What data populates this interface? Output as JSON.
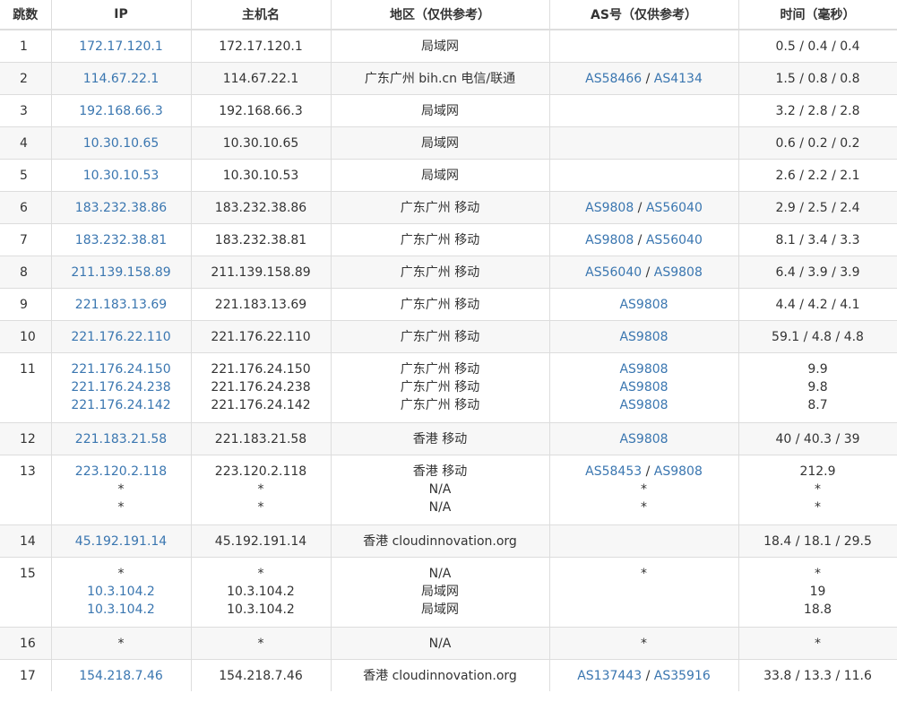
{
  "columns": [
    "跳数",
    "IP",
    "主机名",
    "地区（仅供参考）",
    "AS号（仅供参考）",
    "时间（毫秒）"
  ],
  "hops": [
    {
      "hop": "1",
      "ips": [
        "172.17.120.1"
      ],
      "hosts": [
        "172.17.120.1"
      ],
      "regions": [
        "局域网"
      ],
      "as": [
        []
      ],
      "times": [
        "0.5 / 0.4 / 0.4"
      ]
    },
    {
      "hop": "2",
      "ips": [
        "114.67.22.1"
      ],
      "hosts": [
        "114.67.22.1"
      ],
      "regions": [
        "广东广州 bih.cn 电信/联通"
      ],
      "as": [
        [
          "AS58466",
          "AS4134"
        ]
      ],
      "times": [
        "1.5 / 0.8 / 0.8"
      ]
    },
    {
      "hop": "3",
      "ips": [
        "192.168.66.3"
      ],
      "hosts": [
        "192.168.66.3"
      ],
      "regions": [
        "局域网"
      ],
      "as": [
        []
      ],
      "times": [
        "3.2 / 2.8 / 2.8"
      ]
    },
    {
      "hop": "4",
      "ips": [
        "10.30.10.65"
      ],
      "hosts": [
        "10.30.10.65"
      ],
      "regions": [
        "局域网"
      ],
      "as": [
        []
      ],
      "times": [
        "0.6 / 0.2 / 0.2"
      ]
    },
    {
      "hop": "5",
      "ips": [
        "10.30.10.53"
      ],
      "hosts": [
        "10.30.10.53"
      ],
      "regions": [
        "局域网"
      ],
      "as": [
        []
      ],
      "times": [
        "2.6 / 2.2 / 2.1"
      ]
    },
    {
      "hop": "6",
      "ips": [
        "183.232.38.86"
      ],
      "hosts": [
        "183.232.38.86"
      ],
      "regions": [
        "广东广州 移动"
      ],
      "as": [
        [
          "AS9808",
          "AS56040"
        ]
      ],
      "times": [
        "2.9 / 2.5 / 2.4"
      ]
    },
    {
      "hop": "7",
      "ips": [
        "183.232.38.81"
      ],
      "hosts": [
        "183.232.38.81"
      ],
      "regions": [
        "广东广州 移动"
      ],
      "as": [
        [
          "AS9808",
          "AS56040"
        ]
      ],
      "times": [
        "8.1 / 3.4 / 3.3"
      ]
    },
    {
      "hop": "8",
      "ips": [
        "211.139.158.89"
      ],
      "hosts": [
        "211.139.158.89"
      ],
      "regions": [
        "广东广州 移动"
      ],
      "as": [
        [
          "AS56040",
          "AS9808"
        ]
      ],
      "times": [
        "6.4 / 3.9 / 3.9"
      ]
    },
    {
      "hop": "9",
      "ips": [
        "221.183.13.69"
      ],
      "hosts": [
        "221.183.13.69"
      ],
      "regions": [
        "广东广州 移动"
      ],
      "as": [
        [
          "AS9808"
        ]
      ],
      "times": [
        "4.4 / 4.2 / 4.1"
      ]
    },
    {
      "hop": "10",
      "ips": [
        "221.176.22.110"
      ],
      "hosts": [
        "221.176.22.110"
      ],
      "regions": [
        "广东广州 移动"
      ],
      "as": [
        [
          "AS9808"
        ]
      ],
      "times": [
        "59.1 / 4.8 / 4.8"
      ]
    },
    {
      "hop": "11",
      "ips": [
        "221.176.24.150",
        "221.176.24.238",
        "221.176.24.142"
      ],
      "hosts": [
        "221.176.24.150",
        "221.176.24.238",
        "221.176.24.142"
      ],
      "regions": [
        "广东广州 移动",
        "广东广州 移动",
        "广东广州 移动"
      ],
      "as": [
        [
          "AS9808"
        ],
        [
          "AS9808"
        ],
        [
          "AS9808"
        ]
      ],
      "times": [
        "9.9",
        "9.8",
        "8.7"
      ]
    },
    {
      "hop": "12",
      "ips": [
        "221.183.21.58"
      ],
      "hosts": [
        "221.183.21.58"
      ],
      "regions": [
        "香港 移动"
      ],
      "as": [
        [
          "AS9808"
        ]
      ],
      "times": [
        "40 / 40.3 / 39"
      ]
    },
    {
      "hop": "13",
      "ips": [
        "223.120.2.118",
        "*",
        "*"
      ],
      "hosts": [
        "223.120.2.118",
        "*",
        "*"
      ],
      "regions": [
        "香港 移动",
        "N/A",
        "N/A"
      ],
      "as": [
        [
          "AS58453",
          "AS9808"
        ],
        [
          "*"
        ],
        [
          "*"
        ]
      ],
      "times": [
        "212.9",
        "*",
        "*"
      ]
    },
    {
      "hop": "14",
      "ips": [
        "45.192.191.14"
      ],
      "hosts": [
        "45.192.191.14"
      ],
      "regions": [
        "香港 cloudinnovation.org"
      ],
      "as": [
        []
      ],
      "times": [
        "18.4 / 18.1 / 29.5"
      ]
    },
    {
      "hop": "15",
      "ips": [
        "*",
        "10.3.104.2",
        "10.3.104.2"
      ],
      "hosts": [
        "*",
        "10.3.104.2",
        "10.3.104.2"
      ],
      "regions": [
        "N/A",
        "局域网",
        "局域网"
      ],
      "as": [
        [
          "*"
        ],
        [],
        []
      ],
      "times": [
        "*",
        "19",
        "18.8"
      ]
    },
    {
      "hop": "16",
      "ips": [
        "*"
      ],
      "hosts": [
        "*"
      ],
      "regions": [
        "N/A"
      ],
      "as": [
        [
          "*"
        ]
      ],
      "times": [
        "*"
      ]
    },
    {
      "hop": "17",
      "ips": [
        "154.218.7.46"
      ],
      "hosts": [
        "154.218.7.46"
      ],
      "regions": [
        "香港 cloudinnovation.org"
      ],
      "as": [
        [
          "AS137443",
          "AS35916"
        ]
      ],
      "times": [
        "33.8 / 13.3 / 11.6"
      ]
    }
  ],
  "colors": {
    "link": "#3a76b0",
    "stripe": "#f7f7f7",
    "border": "#dddddd"
  }
}
